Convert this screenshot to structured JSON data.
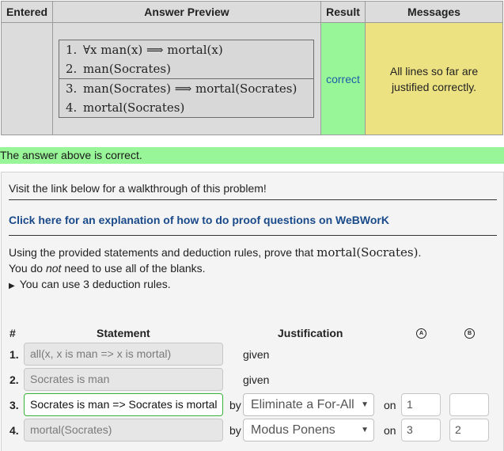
{
  "table": {
    "headers": {
      "entered": "Entered",
      "preview": "Answer Preview",
      "result": "Result",
      "messages": "Messages"
    },
    "proof_lines": [
      {
        "num": "1.",
        "text": "∀x man(x) ⟹ mortal(x)"
      },
      {
        "num": "2.",
        "text": "man(Socrates)"
      },
      {
        "num": "3.",
        "text": "man(Socrates) ⟹ mortal(Socrates)"
      },
      {
        "num": "4.",
        "text": "mortal(Socrates)"
      }
    ],
    "result": "correct",
    "message_line1": "All lines so far are",
    "message_line2": "justified correctly."
  },
  "status": {
    "correct_text": "The answer above is correct."
  },
  "colors": {
    "correct_green": "#98f598",
    "message_yellow": "#ece282",
    "link_blue": "#1a4a8a",
    "active_border": "#38b238"
  },
  "problem": {
    "walkthrough_text": "Visit the link below for a walkthrough of this problem!",
    "explain_link": "Click here for an explanation of how to do proof questions on WeBWorK",
    "instruction_prefix": "Using the provided statements and deduction rules, prove that ",
    "instruction_target": "mortal(Socrates)",
    "instruction_suffix": ".",
    "blanks_prefix": "You do ",
    "blanks_emph": "not",
    "blanks_suffix": " need to use all of the blanks.",
    "rules_summary": "You can use 3 deduction rules."
  },
  "proof_table": {
    "headers": {
      "num": "#",
      "statement": "Statement",
      "justification": "Justification",
      "ref_a": "A",
      "ref_b": "B"
    },
    "by_label": "by",
    "on_label": "on",
    "rows": [
      {
        "num": "1.",
        "statement": "all(x, x is man => x is mortal)",
        "justification": "given",
        "rule": "",
        "ref_a": "",
        "ref_b": ""
      },
      {
        "num": "2.",
        "statement": "Socrates is man",
        "justification": "given",
        "rule": "",
        "ref_a": "",
        "ref_b": ""
      },
      {
        "num": "3.",
        "statement": "Socrates is man => Socrates is mortal",
        "justification": "",
        "rule": "Eliminate a For-All",
        "ref_a": "1",
        "ref_b": ""
      },
      {
        "num": "4.",
        "statement": "mortal(Socrates)",
        "justification": "",
        "rule": "Modus Ponens",
        "ref_a": "3",
        "ref_b": "2"
      }
    ]
  }
}
